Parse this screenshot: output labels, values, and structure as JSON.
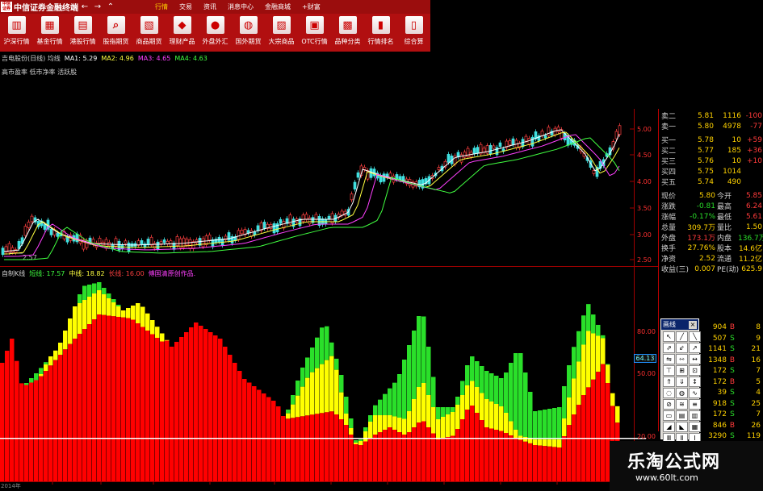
{
  "window": {
    "title": "中信证券金融终端",
    "logo_text": "中信证券",
    "nav": [
      "←",
      "→",
      "⌃"
    ]
  },
  "menu": [
    "行情",
    "交易",
    "资讯",
    "消息中心",
    "金融商城",
    "+财富"
  ],
  "toolbar": [
    {
      "label": "沪深行情",
      "icon": "chart-icon",
      "glyph": "▥"
    },
    {
      "label": "基金行情",
      "icon": "fund-icon",
      "glyph": "▦"
    },
    {
      "label": "港股行情",
      "icon": "hk-icon",
      "glyph": "▤"
    },
    {
      "label": "股指期货",
      "icon": "magnifier-icon",
      "glyph": "⌕"
    },
    {
      "label": "商品期货",
      "icon": "commodity-icon",
      "glyph": "▧"
    },
    {
      "label": "理财产品",
      "icon": "finance-icon",
      "glyph": "◆"
    },
    {
      "label": "外盘外汇",
      "icon": "forex-icon",
      "glyph": "●"
    },
    {
      "label": "国外期货",
      "icon": "globe-icon",
      "glyph": "◍"
    },
    {
      "label": "大宗商品",
      "icon": "bulk-icon",
      "glyph": "▨"
    },
    {
      "label": "OTC行情",
      "icon": "otc-icon",
      "glyph": "▣"
    },
    {
      "label": "品种分类",
      "icon": "category-icon",
      "glyph": "▩"
    },
    {
      "label": "行情排名",
      "icon": "ranking-icon",
      "glyph": "▮"
    },
    {
      "label": "综合算",
      "icon": "calc-icon",
      "glyph": "▯"
    }
  ],
  "ma_line": [
    {
      "text": "吉电股份(日线) 均线",
      "color": "#d0d0d0"
    },
    {
      "text": "MA1: 5.29",
      "color": "#ffffff"
    },
    {
      "text": "MA2: 4.96",
      "color": "#ffff40"
    },
    {
      "text": "MA3: 4.65",
      "color": "#ff40ff"
    },
    {
      "text": "MA4: 4.63",
      "color": "#40ff40"
    }
  ],
  "tag_line": "高市盈率 低市净率 活跃股",
  "indicator_header": [
    {
      "text": "自制K线",
      "color": "#d0d0d0"
    },
    {
      "text": "短线: 17.57",
      "color": "#40ff40"
    },
    {
      "text": "中线: 18.82",
      "color": "#ffff40"
    },
    {
      "text": "长线: 16.00",
      "color": "#ff4040"
    },
    {
      "text": "傅国清原创作品.",
      "color": "#ff40ff"
    }
  ],
  "price_axis": [
    "5.00",
    "4.50",
    "4.00",
    "3.50",
    "3.00",
    "2.50"
  ],
  "indicator_axis": [
    "80.00",
    "50.00",
    "20.00"
  ],
  "low_label": "2.57",
  "price_marker": "64.13",
  "quotes_top": [
    {
      "label": "卖二",
      "price": "5.81",
      "vol": "1116",
      "chg": "-100"
    },
    {
      "label": "卖一",
      "price": "5.80",
      "vol": "4978",
      "chg": "-77"
    },
    {
      "label": "买一",
      "price": "5.78",
      "vol": "10",
      "chg": "+59"
    },
    {
      "label": "买二",
      "price": "5.77",
      "vol": "185",
      "chg": "+36"
    },
    {
      "label": "买三",
      "price": "5.76",
      "vol": "10",
      "chg": "+10"
    },
    {
      "label": "买四",
      "price": "5.75",
      "vol": "1014",
      "chg": ""
    },
    {
      "label": "买五",
      "price": "5.74",
      "vol": "490",
      "chg": ""
    }
  ],
  "stats": [
    {
      "l1": "现价",
      "v1": "5.80",
      "c1": "yellow",
      "l2": "今开",
      "v2": "5.85",
      "c2": "red"
    },
    {
      "l1": "涨跌",
      "v1": "-0.81",
      "c1": "green",
      "l2": "最高",
      "v2": "6.24",
      "c2": "red"
    },
    {
      "l1": "涨幅",
      "v1": "-0.17%",
      "c1": "green",
      "l2": "最低",
      "v2": "5.61",
      "c2": "red"
    },
    {
      "l1": "总量",
      "v1": "309.7万",
      "c1": "yellow",
      "l2": "量比",
      "v2": "1.50",
      "c2": "yellow"
    },
    {
      "l1": "外盘",
      "v1": "173.1万",
      "c1": "red",
      "l2": "内盘",
      "v2": "136.7万",
      "c2": "green"
    },
    {
      "l1": "换手",
      "v1": "27.76%",
      "c1": "yellow",
      "l2": "股本",
      "v2": "14.6亿",
      "c2": "yellow"
    },
    {
      "l1": "净资",
      "v1": "2.52",
      "c1": "yellow",
      "l2": "流通",
      "v2": "11.2亿",
      "c2": "yellow"
    },
    {
      "l1": "收益(三)",
      "v1": "0.007",
      "c1": "yellow",
      "l2": "PE(动)",
      "v2": "625.9",
      "c2": "yellow"
    }
  ],
  "ticks": [
    {
      "v": "904",
      "s": "B",
      "n": "8"
    },
    {
      "v": "507",
      "s": "S",
      "n": "9"
    },
    {
      "v": "1141",
      "s": "S",
      "n": "21"
    },
    {
      "v": "1348",
      "s": "B",
      "n": "16"
    },
    {
      "v": "172",
      "s": "S",
      "n": "7"
    },
    {
      "v": "172",
      "s": "B",
      "n": "5"
    },
    {
      "v": "39",
      "s": "S",
      "n": "4"
    },
    {
      "v": "918",
      "s": "S",
      "n": "25"
    },
    {
      "v": "172",
      "s": "S",
      "n": "7"
    },
    {
      "v": "846",
      "s": "B",
      "n": "26"
    },
    {
      "v": "3290",
      "s": "S",
      "n": "119"
    }
  ],
  "palette": {
    "title": "画线",
    "close": "×",
    "tools": [
      "↖",
      "╱",
      "╲",
      "⇗",
      "⇙",
      "↗",
      "⇋",
      "⇿",
      "↔",
      "⊤",
      "⊞",
      "⊡",
      "⇑",
      "⇓",
      "↕",
      "◌",
      "◍",
      "∿",
      "⊘",
      "≋",
      "≡",
      "▭",
      "▤",
      "▥",
      "◢",
      "◣",
      "▦",
      "Ⅲ",
      "Ⅱ",
      "Ⅰ"
    ]
  },
  "watermark": {
    "title": "乐淘公式网",
    "url": "www.60lt.com"
  },
  "bottom_date": "2014年",
  "chart_data": {
    "type": "bar",
    "title": "",
    "series": [
      {
        "name": "短线",
        "color": "#2adf2a"
      },
      {
        "name": "中线",
        "color": "#ffff00"
      },
      {
        "name": "长线",
        "color": "#ff0000"
      }
    ],
    "ylim": [
      20,
      80
    ],
    "note_values_estimated": true
  }
}
